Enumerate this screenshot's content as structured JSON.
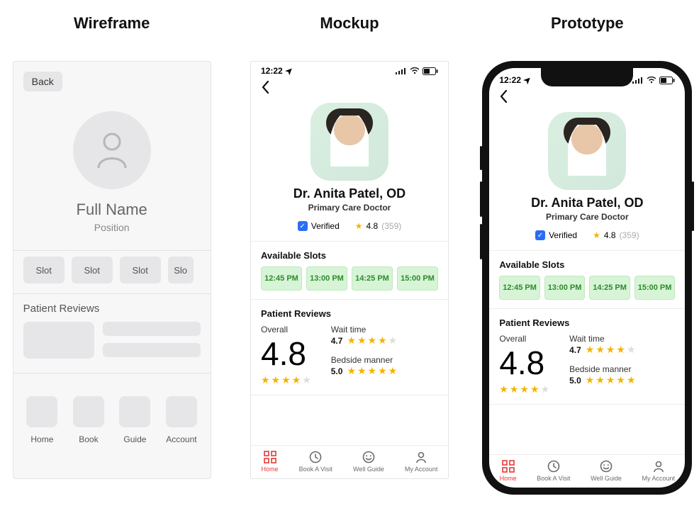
{
  "columns": {
    "wireframe": "Wireframe",
    "mockup": "Mockup",
    "prototype": "Prototype"
  },
  "wireframe": {
    "back": "Back",
    "name": "Full Name",
    "position": "Position",
    "slot_label": "Slot",
    "reviews_title": "Patient Reviews",
    "tabs": [
      "Home",
      "Book",
      "Guide",
      "Account"
    ]
  },
  "app": {
    "time": "12:22",
    "doctor_name": "Dr. Anita Patel, OD",
    "doctor_role": "Primary Care Doctor",
    "verified_label": "Verified",
    "rating": "4.8",
    "rating_count": "(359)",
    "slots_title": "Available Slots",
    "slots": [
      "12:45 PM",
      "13:00 PM",
      "14:25 PM",
      "15:00 PM"
    ],
    "reviews_title": "Patient Reviews",
    "overall_label": "Overall",
    "overall_score": "4.8",
    "wait_label": "Wait time",
    "wait_score": "4.7",
    "bedside_label": "Bedside manner",
    "bedside_score": "5.0",
    "tabs": {
      "home": "Home",
      "book": "Book A Visit",
      "guide": "Well Guide",
      "account": "My Account"
    }
  },
  "icons": {
    "location_arrow": "➤",
    "check": "✓",
    "star": "★",
    "star_off": "★",
    "chevron_left": "‹",
    "grid": "⊞"
  }
}
